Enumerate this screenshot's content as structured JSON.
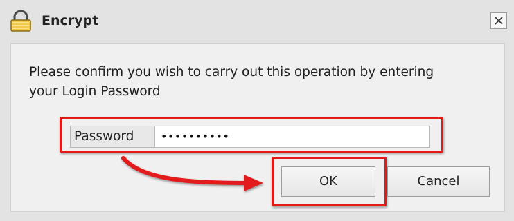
{
  "dialog": {
    "title": "Encrypt",
    "title_icon": "padlock-icon",
    "close_icon": "close-icon"
  },
  "message": {
    "line1": "Please confirm you wish to carry out this operation by entering",
    "line2": "your Login Password"
  },
  "password": {
    "label": "Password",
    "masked_value": "••••••••••"
  },
  "buttons": {
    "ok_label": "OK",
    "cancel_label": "Cancel"
  },
  "annotation": {
    "highlight_color": "#e21a1a",
    "arrow_icon": "curved-arrow-icon"
  }
}
